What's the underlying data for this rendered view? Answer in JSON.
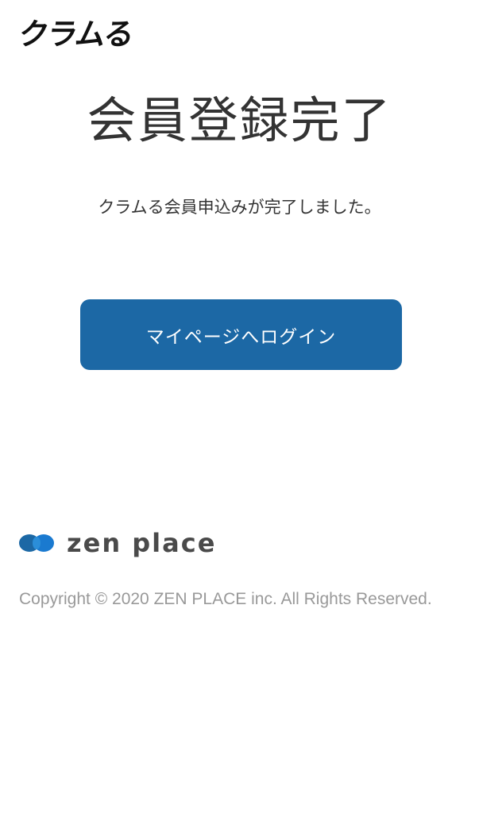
{
  "header": {
    "logo_text": "クラムる"
  },
  "main": {
    "title": "会員登録完了",
    "message": "クラムる会員申込みが完了しました。",
    "login_button_label": "マイページへログイン"
  },
  "footer": {
    "company_logo_text": "zen place",
    "copyright": "Copyright © 2020 ZEN PLACE inc. All Rights Reserved."
  },
  "colors": {
    "primary_button": "#1c68a5",
    "logo_blue": "#1a7ad0",
    "title_text": "#333333",
    "copyright_text": "#999999"
  }
}
